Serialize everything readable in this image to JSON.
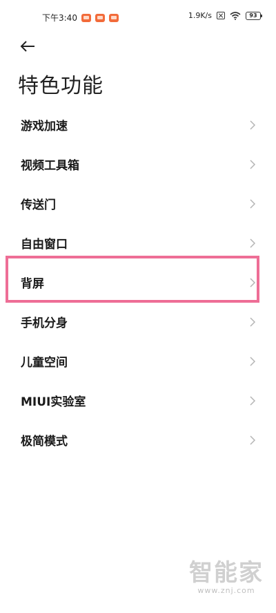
{
  "status_bar": {
    "time": "下午3:40",
    "network_speed": "1.9K/s",
    "battery": "93",
    "icons": [
      "notification-icon",
      "notification-icon",
      "notification-icon",
      "sim-icon",
      "wifi-icon",
      "battery-icon"
    ]
  },
  "header": {
    "back_icon": "arrow-left-icon",
    "title": "特色功能"
  },
  "menu": {
    "items": [
      {
        "label": "游戏加速"
      },
      {
        "label": "视频工具箱"
      },
      {
        "label": "传送门"
      },
      {
        "label": "自由窗口"
      },
      {
        "label": "背屏"
      },
      {
        "label": "手机分身"
      },
      {
        "label": "儿童空间"
      },
      {
        "label": "MIUI实验室"
      },
      {
        "label": "极简模式"
      }
    ],
    "highlighted_index": 4,
    "highlight_color": "#ee6e96"
  },
  "watermark": {
    "main": "智能家",
    "sub": "www.znj.com"
  }
}
